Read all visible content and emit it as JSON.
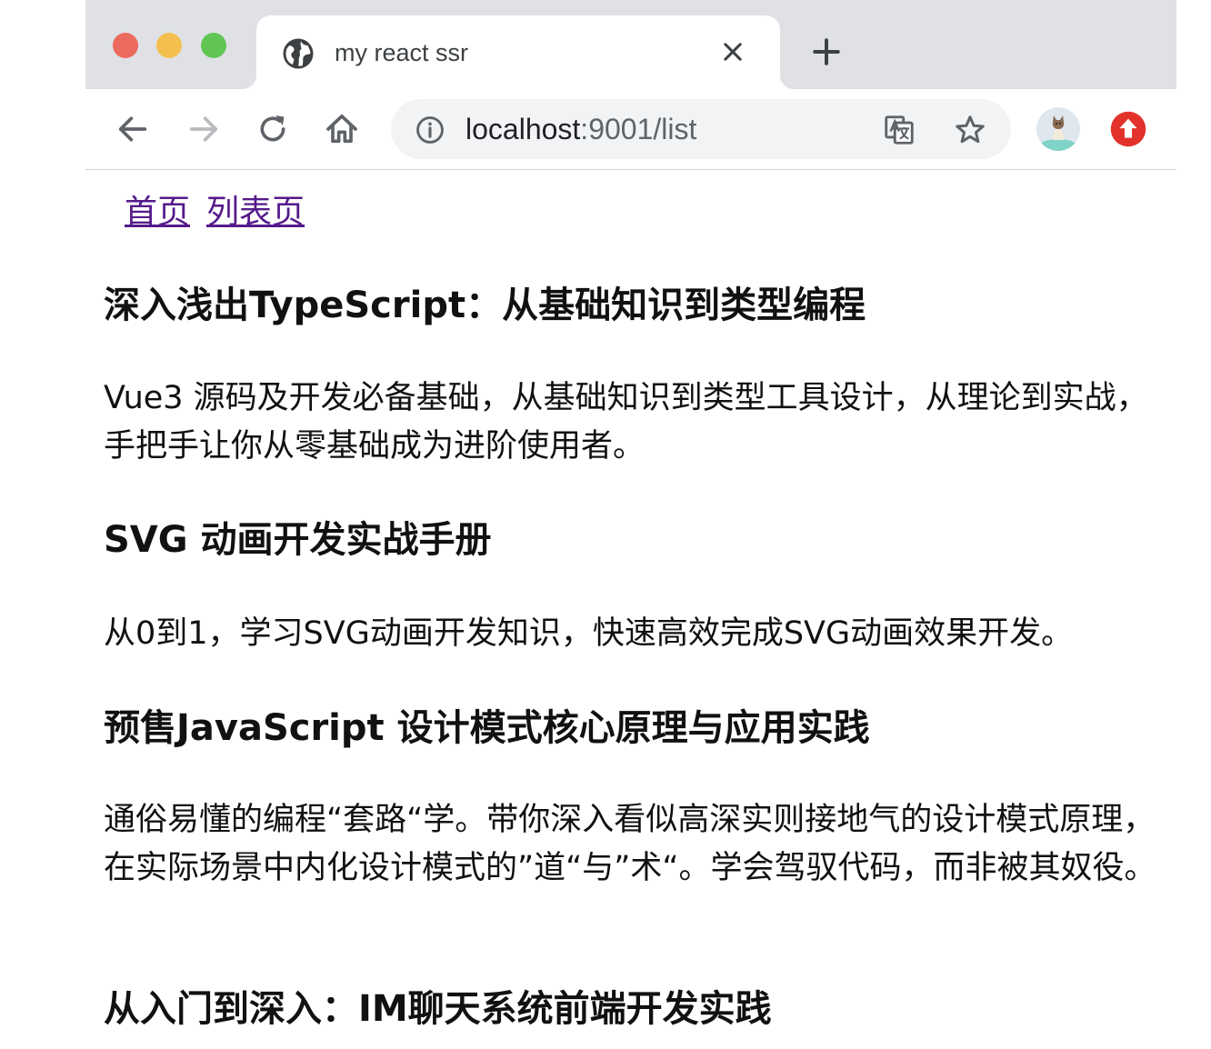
{
  "browser": {
    "tab_title": "my react ssr",
    "url_host": "localhost",
    "url_rest": ":9001/list"
  },
  "nav": {
    "home_label": "首页",
    "list_label": "列表页"
  },
  "articles": [
    {
      "title": "深入浅出TypeScript：从基础知识到类型编程",
      "desc": "Vue3 源码及开发必备基础，从基础知识到类型工具设计，从理论到实战，手把手让你从零基础成为进阶使用者。"
    },
    {
      "title": "SVG 动画开发实战手册",
      "desc": "从0到1，学习SVG动画开发知识，快速高效完成SVG动画效果开发。"
    },
    {
      "title": "预售JavaScript 设计模式核心原理与应用实践",
      "desc": "通俗易懂的编程“套路“学。带你深入看似高深实则接地气的设计模式原理，在实际场景中内化设计模式的”道“与”术“。学会驾驭代码，而非被其奴役。"
    },
    {
      "title": "从入门到深入：IM聊天系统前端开发实践",
      "desc": ""
    }
  ]
}
